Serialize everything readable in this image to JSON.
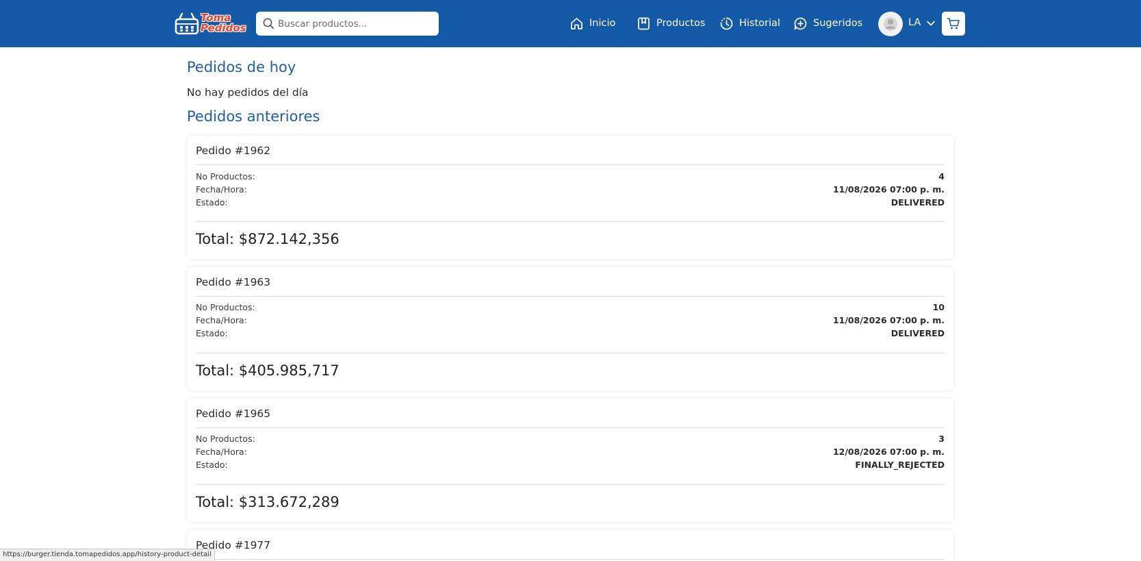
{
  "brand": {
    "name": "Toma Pedidos",
    "primary_color": "#1459a5",
    "logo_text_color": "#e8432b"
  },
  "search": {
    "placeholder": "Buscar productos..."
  },
  "nav": [
    {
      "label": "Inicio",
      "icon": "home-icon"
    },
    {
      "label": "Productos",
      "icon": "bookmark-icon"
    },
    {
      "label": "Historial",
      "icon": "history-icon"
    },
    {
      "label": "Sugeridos",
      "icon": "plus-circle-icon"
    }
  ],
  "user": {
    "initials": "LA",
    "avatar_icon": "user-avatar-icon",
    "menu_icon": "chevron-down-icon"
  },
  "cart": {
    "icon": "cart-icon"
  },
  "today": {
    "title": "Pedidos de hoy",
    "empty_message": "No hay pedidos del día"
  },
  "previous": {
    "title": "Pedidos anteriores",
    "labels": {
      "products": "No Productos:",
      "datetime": "Fecha/Hora:",
      "status": "Estado:"
    },
    "orders": [
      {
        "title": "Pedido #1962",
        "products": "4",
        "datetime": "11/08/2026 07:00 p. m.",
        "status": "DELIVERED",
        "total": "Total: $872.142,356"
      },
      {
        "title": "Pedido #1963",
        "products": "10",
        "datetime": "11/08/2026 07:00 p. m.",
        "status": "DELIVERED",
        "total": "Total: $405.985,717"
      },
      {
        "title": "Pedido #1965",
        "products": "3",
        "datetime": "12/08/2026 07:00 p. m.",
        "status": "FINALLY_REJECTED",
        "total": "Total: $313.672,289"
      },
      {
        "title": "Pedido #1977"
      }
    ]
  },
  "status_bar": {
    "url": "https://burger.tienda.tomapedidos.app/history-product-detail"
  }
}
